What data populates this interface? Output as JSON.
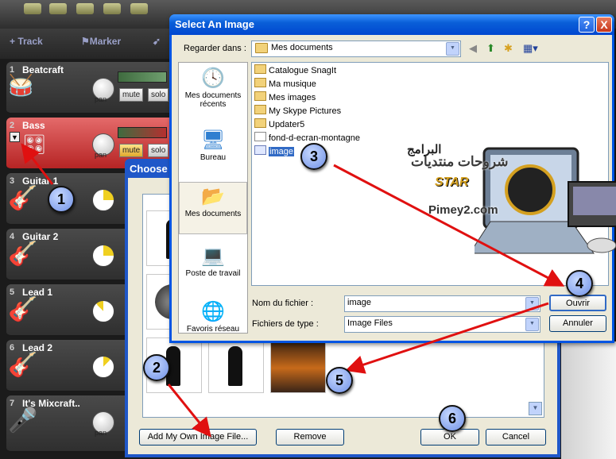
{
  "mixcraft": {
    "header": {
      "track_label": "Track",
      "marker_label": "Marker"
    },
    "tracks": [
      {
        "number": "1",
        "name": "Beatcraft",
        "pan": "pan",
        "mute": "mute",
        "solo": "solo"
      },
      {
        "number": "2",
        "name": "Bass",
        "pan": "pan",
        "mute": "mute",
        "solo": "solo"
      },
      {
        "number": "3",
        "name": "Guitar 1"
      },
      {
        "number": "4",
        "name": "Guitar 2"
      },
      {
        "number": "5",
        "name": "Lead 1"
      },
      {
        "number": "6",
        "name": "Lead 2"
      },
      {
        "number": "7",
        "name": "It's Mixcraft..",
        "pan": "pan"
      }
    ]
  },
  "choose_dialog": {
    "title": "Choose",
    "add_button": "Add My Own Image File...",
    "remove_button": "Remove",
    "ok_button": "OK",
    "cancel_button": "Cancel"
  },
  "select_dialog": {
    "title": "Select An Image",
    "help": "?",
    "close": "X",
    "look_in_label": "Regarder dans :",
    "look_in_value": "Mes documents",
    "places": [
      "Mes documents récents",
      "Bureau",
      "Mes documents",
      "Poste de travail",
      "Favoris réseau"
    ],
    "files": [
      {
        "name": "Catalogue SnagIt",
        "kind": "folder"
      },
      {
        "name": "Ma musique",
        "kind": "folder"
      },
      {
        "name": "Mes images",
        "kind": "folder"
      },
      {
        "name": "My Skype Pictures",
        "kind": "folder"
      },
      {
        "name": "Updater5",
        "kind": "folder"
      },
      {
        "name": "fond-d-ecran-montagne",
        "kind": "image"
      },
      {
        "name": "image",
        "kind": "image",
        "selected": true
      }
    ],
    "filename_label": "Nom du fichier :",
    "filename_value": "image",
    "filetype_label": "Fichiers de type :",
    "filetype_value": "Image Files",
    "open_button": "Ouvrir",
    "cancel_button": "Annuler",
    "watermark": {
      "line1": "شروحات منتديات",
      "line2": "البرامج",
      "star": "STAR",
      "site": "Pimey2.com"
    }
  },
  "annotations": {
    "steps": [
      "1",
      "2",
      "3",
      "4",
      "5",
      "6"
    ],
    "arrow_color": "#e01010"
  },
  "colors": {
    "xp_title_blue": "#0054e3",
    "dialog_face": "#ece9d8",
    "selection": "#316ac5",
    "track_red": "#c83030"
  }
}
